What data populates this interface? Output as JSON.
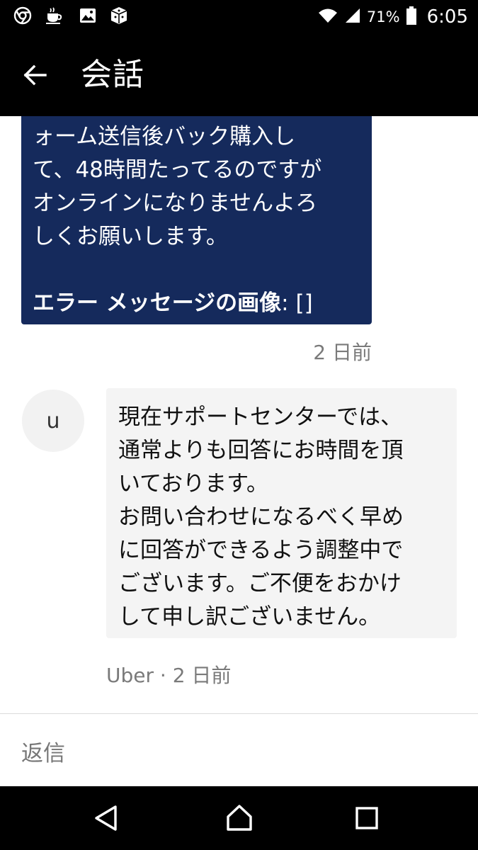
{
  "status_bar": {
    "battery_percent": "71%",
    "time": "6:05",
    "icons": [
      "chrome-icon",
      "coffee-icon",
      "image-icon",
      "app-box-icon",
      "wifi-icon",
      "signal-icon",
      "battery-icon"
    ]
  },
  "header": {
    "title": "会話"
  },
  "messages": {
    "outgoing": {
      "text": "ォーム送信後バック購入し\nて、48時間たってるのですが\nオンラインになりませんよろ\nしくお願いします。",
      "error_label": "エラー メッセージの画像",
      "error_value": ": []",
      "time": "2 日前"
    },
    "incoming": {
      "avatar_letter": "u",
      "text": "現在サポートセンターでは、\n通常よりも回答にお時間を頂\nいております。\nお問い合わせになるべく早め\nに回答ができるよう調整中で\nございます。ご不便をおかけ\nして申し訳ございません。",
      "meta": "Uber · 2 日前"
    }
  },
  "reply": {
    "placeholder": "返信"
  },
  "colors": {
    "outgoing_bubble": "#152a5c",
    "incoming_bubble": "#f4f4f4",
    "bars": "#000000"
  }
}
